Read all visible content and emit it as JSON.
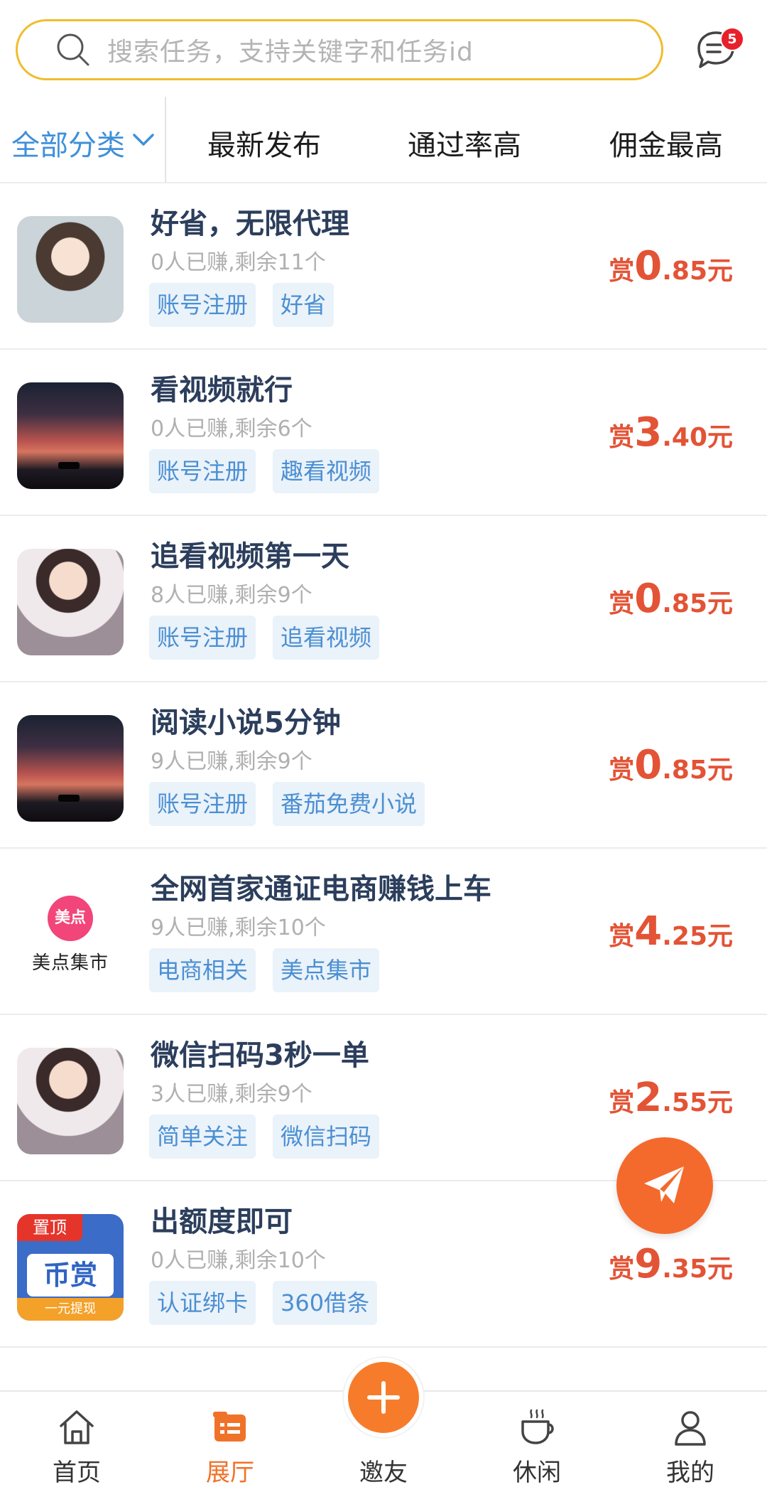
{
  "search": {
    "placeholder": "搜索任务，支持关键字和任务id"
  },
  "messages": {
    "badge_count": "5"
  },
  "filters": {
    "category": "全部分类",
    "tabs": [
      "最新发布",
      "通过率高",
      "佣金最高"
    ]
  },
  "tasks": [
    {
      "title": "好省，无限代理",
      "meta": "0人已赚,剩余11个",
      "tags": [
        "账号注册",
        "好省"
      ],
      "reward_prefix": "赏",
      "reward_int": "0",
      "reward_dec": ".85元"
    },
    {
      "title": "看视频就行",
      "meta": "0人已赚,剩余6个",
      "tags": [
        "账号注册",
        "趣看视频"
      ],
      "reward_prefix": "赏",
      "reward_int": "3",
      "reward_dec": ".40元"
    },
    {
      "title": "追看视频第一天",
      "meta": "8人已赚,剩余9个",
      "tags": [
        "账号注册",
        "追看视频"
      ],
      "reward_prefix": "赏",
      "reward_int": "0",
      "reward_dec": ".85元"
    },
    {
      "title": "阅读小说5分钟",
      "meta": "9人已赚,剩余9个",
      "tags": [
        "账号注册",
        "番茄免费小说"
      ],
      "reward_prefix": "赏",
      "reward_int": "0",
      "reward_dec": ".85元"
    },
    {
      "title": "全网首家通证电商赚钱上车",
      "meta": "9人已赚,剩余10个",
      "tags": [
        "电商相关",
        "美点集市"
      ],
      "reward_prefix": "赏",
      "reward_int": "4",
      "reward_dec": ".25元",
      "logo_badge": "美点",
      "logo_name": "美点集市"
    },
    {
      "title": "微信扫码3秒一单",
      "meta": "3人已赚,剩余9个",
      "tags": [
        "简单关注",
        "微信扫码"
      ],
      "reward_prefix": "赏",
      "reward_int": "2",
      "reward_dec": ".55元"
    },
    {
      "title": "出额度即可",
      "meta": "0人已赚,剩余10个",
      "tags": [
        "认证绑卡",
        "360借条"
      ],
      "reward_prefix": "赏",
      "reward_int": "9",
      "reward_dec": ".35元",
      "pin_tag": "置顶",
      "logo_name": "币赏",
      "logo_sub": "一元提现"
    }
  ],
  "nav": {
    "items": [
      {
        "label": "首页",
        "icon": "home-icon"
      },
      {
        "label": "展厅",
        "icon": "hall-icon",
        "active": true
      },
      {
        "label": "邀友",
        "icon": "plus-icon"
      },
      {
        "label": "休闲",
        "icon": "cup-icon"
      },
      {
        "label": "我的",
        "icon": "user-icon"
      }
    ]
  },
  "colors": {
    "accent": "#f07228",
    "price": "#e35335",
    "tag_text": "#4b8fd2",
    "tag_bg": "#eaf2fa",
    "search_border": "#f0bd2e",
    "active_filter": "#3f90d8"
  }
}
